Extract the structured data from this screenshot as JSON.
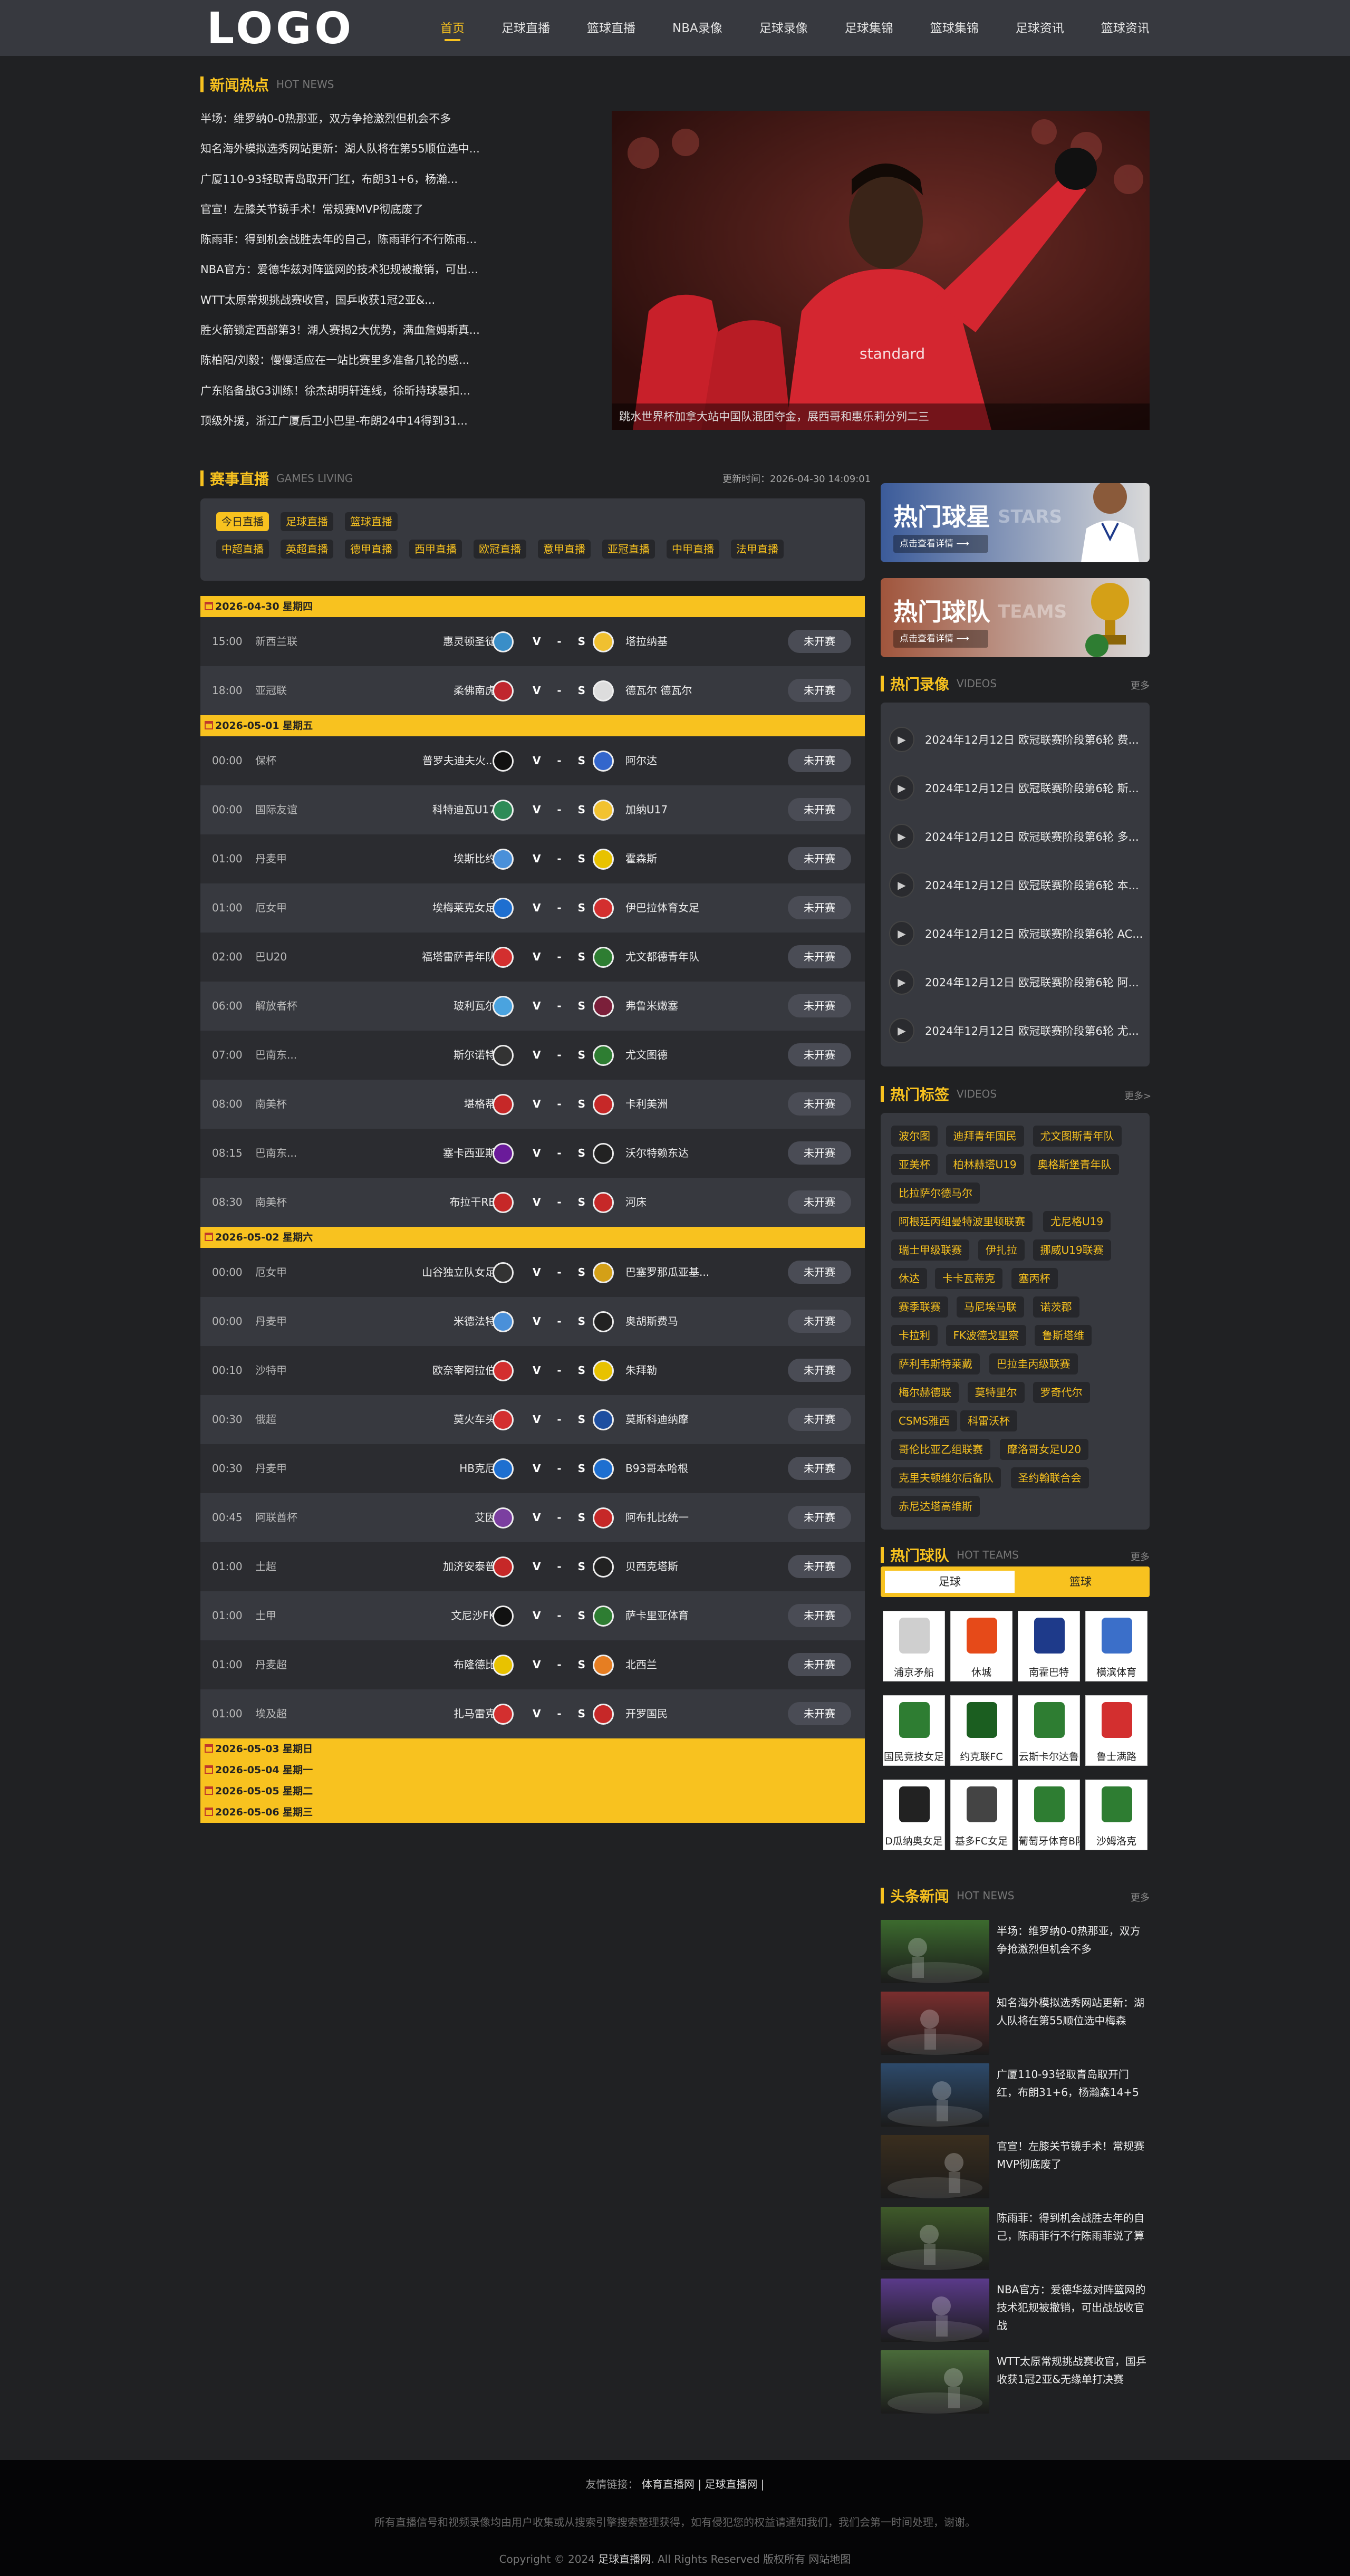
{
  "header": {
    "logo": "LOGO",
    "nav": [
      "首页",
      "足球直播",
      "篮球直播",
      "NBA录像",
      "足球录像",
      "足球集锦",
      "篮球集锦",
      "足球资讯",
      "篮球资讯"
    ]
  },
  "news_hot": {
    "title": "新闻热点",
    "subtitle": "HOT NEWS",
    "items": [
      "半场：维罗纳0-0热那亚，双方争抢激烈但机会不多",
      "知名海外模拟选秀网站更新：湖人队将在第55顺位选中...",
      "广厦110-93轻取青岛取开门红，布朗31+6，杨瀚...",
      "官宣！左膝关节镜手术！常规赛MVP彻底废了",
      "陈雨菲：得到机会战胜去年的自己，陈雨菲行不行陈雨...",
      "NBA官方：爱德华兹对阵篮网的技术犯规被撤销，可出...",
      "WTT太原常规挑战赛收官，国乒收获1冠2亚&...",
      "胜火箭锁定西部第3！湖人赛揭2大优势，满血詹姆斯真...",
      "陈柏阳/刘毅：慢慢适应在一站比赛里多准备几轮的感...",
      "广东陷备战G3训练！徐杰胡明轩连线，徐昕持球暴扣...",
      "顶级外援，浙江广厦后卫小巴里-布朗24中14得到31..."
    ],
    "hero_caption": "跳水世界杯加拿大站中国队混团夺金，展西哥和惠乐莉分列二三"
  },
  "games": {
    "title": "赛事直播",
    "subtitle": "GAMES LIVING",
    "updated_label": "更新时间：2026-04-30 14:09:01",
    "filters_row1": [
      "今日直播",
      "足球直播",
      "篮球直播"
    ],
    "filters_row2": [
      "中超直播",
      "英超直播",
      "德甲直播",
      "西甲直播",
      "欧冠直播",
      "意甲直播",
      "亚冠直播",
      "中甲直播",
      "法甲直播"
    ],
    "status_label": "未开赛",
    "vs_left": "V",
    "vs_mid": "-",
    "vs_right": "S",
    "days": [
      {
        "date": "2026-04-30 星期四",
        "matches": [
          {
            "time": "15:00",
            "league": "新西兰联",
            "home": "惠灵顿圣徒",
            "away": "塔拉纳基",
            "hc": "#3a8ec8",
            "ac": "#f0c030"
          },
          {
            "time": "18:00",
            "league": "亚冠联",
            "home": "柔佛南虎",
            "away": "德瓦尔 德瓦尔",
            "hc": "#c0262e",
            "ac": "#dddddd"
          }
        ]
      },
      {
        "date": "2026-05-01 星期五",
        "matches": [
          {
            "time": "00:00",
            "league": "保杯",
            "home": "普罗夫迪夫火...",
            "away": "阿尔达",
            "hc": "#111111",
            "ac": "#3366cc"
          },
          {
            "time": "00:00",
            "league": "国际友谊",
            "home": "科特迪瓦U17",
            "away": "加纳U17",
            "hc": "#2e8b57",
            "ac": "#f2c230"
          },
          {
            "time": "01:00",
            "league": "丹麦甲",
            "home": "埃斯比约",
            "away": "霍森斯",
            "hc": "#4a90d9",
            "ac": "#e8c200"
          },
          {
            "time": "01:00",
            "league": "厄女甲",
            "home": "埃梅莱克女足",
            "away": "伊巴拉体育女足",
            "hc": "#1e6fd0",
            "ac": "#d32f2f"
          },
          {
            "time": "02:00",
            "league": "巴U20",
            "home": "福塔雷萨青年队",
            "away": "尤文都德青年队",
            "hc": "#d32f2f",
            "ac": "#2e7d32"
          },
          {
            "time": "06:00",
            "league": "解放者杯",
            "home": "玻利瓦尔",
            "away": "弗鲁米嫩塞",
            "hc": "#4aa3df",
            "ac": "#7b1f3a"
          },
          {
            "time": "07:00",
            "league": "巴南东...",
            "home": "斯尔诺特",
            "away": "尤文图德",
            "hc": "#333333",
            "ac": "#2e7d32"
          },
          {
            "time": "08:00",
            "league": "南美杯",
            "home": "堪格蒂",
            "away": "卡利美洲",
            "hc": "#c62828",
            "ac": "#c62828"
          },
          {
            "time": "08:15",
            "league": "巴南东...",
            "home": "塞卡西亚斯",
            "away": "沃尔特赖东达",
            "hc": "#6a1b9a",
            "ac": "#222222"
          },
          {
            "time": "08:30",
            "league": "南美杯",
            "home": "布拉干RB",
            "away": "河床",
            "hc": "#c62828",
            "ac": "#c62828"
          }
        ]
      },
      {
        "date": "2026-05-02 星期六",
        "matches": [
          {
            "time": "00:00",
            "league": "厄女甲",
            "home": "山谷独立队女足",
            "away": "巴塞罗那瓜亚基...",
            "hc": "#333333",
            "ac": "#d4a017"
          },
          {
            "time": "00:00",
            "league": "丹麦甲",
            "home": "米德法特",
            "away": "奥胡斯费马",
            "hc": "#4a90d9",
            "ac": "#222222"
          },
          {
            "time": "00:10",
            "league": "沙特甲",
            "home": "欧奈宰阿拉伯",
            "away": "朱拜勒",
            "hc": "#d32f2f",
            "ac": "#e8c200"
          },
          {
            "time": "00:30",
            "league": "俄超",
            "home": "莫火车头",
            "away": "莫斯科迪纳摩",
            "hc": "#d32f2f",
            "ac": "#1e4fa0"
          },
          {
            "time": "00:30",
            "league": "丹麦甲",
            "home": "HB克厄",
            "away": "B93哥本哈根",
            "hc": "#1e6fd0",
            "ac": "#1e6fd0"
          },
          {
            "time": "00:45",
            "league": "阿联酋杯",
            "home": "艾因",
            "away": "阿布扎比统一",
            "hc": "#7b3fa0",
            "ac": "#c62828"
          },
          {
            "time": "01:00",
            "league": "土超",
            "home": "加济安泰普",
            "away": "贝西克塔斯",
            "hc": "#c62828",
            "ac": "#222222"
          },
          {
            "time": "01:00",
            "league": "土甲",
            "home": "文尼沙FK",
            "away": "萨卡里亚体育",
            "hc": "#111111",
            "ac": "#2e7d32"
          },
          {
            "time": "01:00",
            "league": "丹麦超",
            "home": "布隆德比",
            "away": "北西兰",
            "hc": "#e8c200",
            "ac": "#e67e22"
          },
          {
            "time": "01:00",
            "league": "埃及超",
            "home": "扎马雷克",
            "away": "开罗国民",
            "hc": "#d32f2f",
            "ac": "#c62828"
          }
        ]
      }
    ],
    "folded_days": [
      "2026-05-03 星期日",
      "2026-05-04 星期一",
      "2026-05-05 星期二",
      "2026-05-06 星期三"
    ]
  },
  "banners": [
    {
      "title": "热门球星",
      "en": "STARS",
      "button": "点击查看详情 ⟶",
      "color": "#3b5b9a"
    },
    {
      "title": "热门球队",
      "en": "TEAMS",
      "button": "点击查看详情 ⟶",
      "color": "#a0553c"
    }
  ],
  "videos": {
    "title": "热门录像",
    "subtitle": "VIDEOS",
    "more": "更多",
    "items": [
      "2024年12月12日 欧冠联赛阶段第6轮 费...",
      "2024年12月12日 欧冠联赛阶段第6轮 斯...",
      "2024年12月12日 欧冠联赛阶段第6轮 多...",
      "2024年12月12日 欧冠联赛阶段第6轮 本...",
      "2024年12月12日 欧冠联赛阶段第6轮 AC...",
      "2024年12月12日 欧冠联赛阶段第6轮 阿...",
      "2024年12月12日 欧冠联赛阶段第6轮 尤..."
    ]
  },
  "tags": {
    "title": "热门标签",
    "subtitle": "VIDEOS",
    "more": "更多>",
    "rows": [
      [
        "波尔图",
        "迪拜青年国民",
        "尤文图斯青年队"
      ],
      [
        "亚美杯",
        "柏林赫塔U19",
        "奥格斯堡青年队"
      ],
      [
        "比拉萨尔德马尔"
      ],
      [
        "阿根廷丙组曼特波里顿联赛",
        "尤尼格U19"
      ],
      [
        "瑞士甲级联赛",
        "伊扎拉",
        "挪威U19联赛"
      ],
      [
        "休达",
        "卡卡瓦蒂克",
        "塞丙杯"
      ],
      [
        "赛季联赛",
        "马尼埃马联",
        "诺茨郡"
      ],
      [
        "卡拉利",
        "FK波德戈里察",
        "鲁斯塔维"
      ],
      [
        "萨利韦斯特莱戴",
        "巴拉圭丙级联赛"
      ],
      [
        "梅尔赫德联",
        "莫特里尔",
        "罗奇代尔"
      ],
      [
        "CSMS雅西",
        "科雷沃杯"
      ],
      [
        "哥伦比亚乙组联赛",
        "摩洛哥女足U20"
      ],
      [
        "克里夫顿维尔后备队",
        "圣约翰联合会"
      ],
      [
        "赤尼达塔高维斯"
      ]
    ]
  },
  "hot_teams": {
    "title": "热门球队",
    "subtitle": "HOT TEAMS",
    "more": "更多",
    "tabs": [
      "足球",
      "篮球"
    ],
    "teams": [
      {
        "name": "浦京矛船",
        "color": "#cfcfcf"
      },
      {
        "name": "休城",
        "color": "#e64a19"
      },
      {
        "name": "南霍巴特",
        "color": "#1e3a8a"
      },
      {
        "name": "横滨体育",
        "color": "#3b6fc9"
      },
      {
        "name": "国民竞技女足",
        "color": "#2e7d32"
      },
      {
        "name": "约克联FC",
        "color": "#1b5e20"
      },
      {
        "name": "云斯卡尔达鲁",
        "color": "#2e7d32"
      },
      {
        "name": "鲁士满路",
        "color": "#d32f2f"
      },
      {
        "name": "D瓜纳奥女足",
        "color": "#222222"
      },
      {
        "name": "基多FC女足",
        "color": "#444444"
      },
      {
        "name": "葡萄牙体育B队",
        "color": "#2e7d32"
      },
      {
        "name": "沙姆洛克",
        "color": "#2e7d32"
      }
    ]
  },
  "headlines": {
    "title": "头条新闻",
    "subtitle": "HOT NEWS",
    "more": "更多",
    "items": [
      {
        "text": "半场：维罗纳0-0热那亚，双方争抢激烈但机会不多",
        "color": "#3c6b2e"
      },
      {
        "text": "知名海外模拟选秀网站更新：湖人队将在第55顺位选中梅森",
        "color": "#7a2e2e"
      },
      {
        "text": "广厦110-93轻取青岛取开门红，布朗31+6，杨瀚森14+5",
        "color": "#2d4a6b"
      },
      {
        "text": "官宣！左膝关节镜手术！常规赛MVP彻底废了",
        "color": "#3a2e1e"
      },
      {
        "text": "陈雨菲：得到机会战胜去年的自己，陈雨菲行不行陈雨菲说了算",
        "color": "#3f5a2a"
      },
      {
        "text": "NBA官方：爱德华兹对阵篮网的技术犯规被撤销，可出战战收官战",
        "color": "#5a3a8a"
      },
      {
        "text": "WTT太原常规挑战赛收官，国乒收获1冠2亚&无缘单打决赛",
        "color": "#4a6b3a"
      }
    ]
  },
  "footer": {
    "links_label": "友情链接：",
    "links": [
      "体育直播网 |",
      "足球直播网 |"
    ],
    "disclaimer": "所有直播信号和视频录像均由用户收集或从搜索引擎搜索整理获得，如有侵犯您的权益请通知我们，我们会第一时间处理，谢谢。",
    "copyright_pre": "Copyright © 2024",
    "copyright_site": "足球直播网",
    "copyright_post": ". All Rights Reserved 版权所有 网站地图"
  }
}
